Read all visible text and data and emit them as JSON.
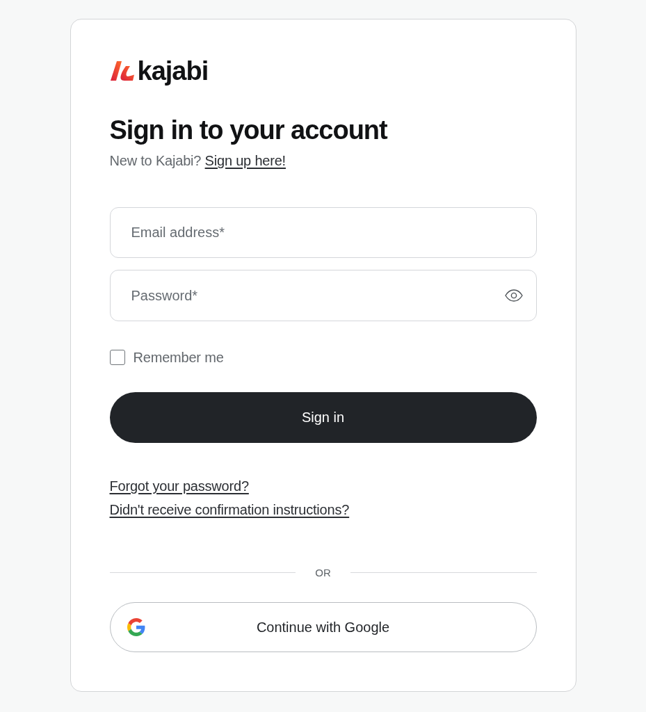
{
  "logo": {
    "wordmark": "kajabi"
  },
  "heading": "Sign in to your account",
  "signup_prompt": {
    "text": "New to Kajabi?",
    "link": "Sign up here!"
  },
  "fields": [
    {
      "kind": "email",
      "placeholder": "Email address*"
    },
    {
      "kind": "password",
      "placeholder": "Password*"
    }
  ],
  "remember_me": {
    "label": "Remember me",
    "checked": false
  },
  "sign_in_button": "Sign in",
  "links": [
    "Forgot your password?",
    "Didn't receive confirmation instructions?"
  ],
  "divider": "OR",
  "google_button": "Continue with Google"
}
